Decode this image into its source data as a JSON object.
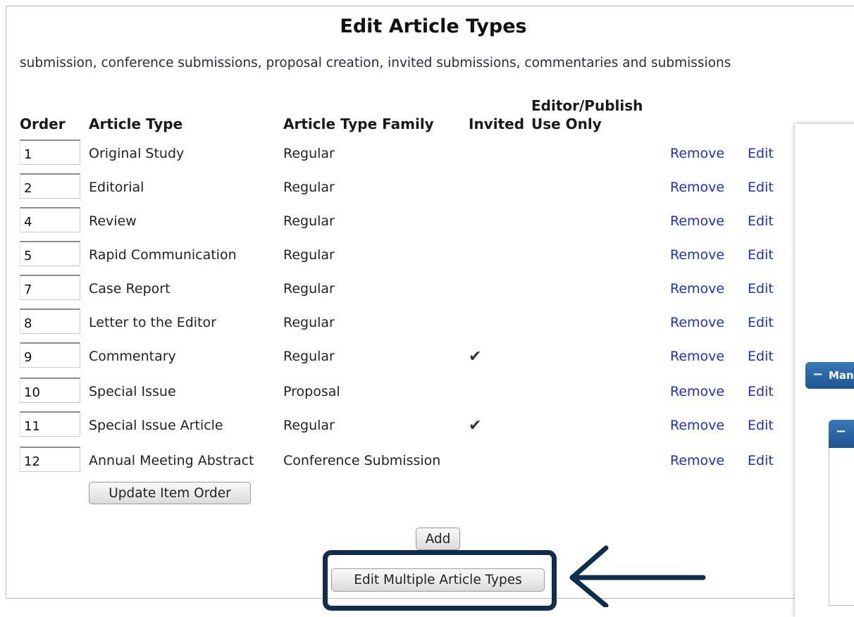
{
  "page": {
    "title": "Edit Article Types",
    "subtitle": "submission, conference submissions, proposal creation, invited submissions, commentaries and submissions"
  },
  "table": {
    "headers": {
      "order": "Order",
      "article_type": "Article Type",
      "family": "Article Type Family",
      "invited": "Invited",
      "editor_line1": "Editor/Publish",
      "editor_line2": "Use Only"
    },
    "rows": [
      {
        "order": "1",
        "type": "Original Study",
        "family": "Regular",
        "invited": false
      },
      {
        "order": "2",
        "type": "Editorial",
        "family": "Regular",
        "invited": false
      },
      {
        "order": "4",
        "type": "Review",
        "family": "Regular",
        "invited": false
      },
      {
        "order": "5",
        "type": "Rapid Communication",
        "family": "Regular",
        "invited": false
      },
      {
        "order": "7",
        "type": "Case Report",
        "family": "Regular",
        "invited": false
      },
      {
        "order": "8",
        "type": "Letter to the Editor",
        "family": "Regular",
        "invited": false
      },
      {
        "order": "9",
        "type": "Commentary",
        "family": "Regular",
        "invited": true
      },
      {
        "order": "10",
        "type": "Special Issue",
        "family": "Proposal",
        "invited": false
      },
      {
        "order": "11",
        "type": "Special Issue Article",
        "family": "Regular",
        "invited": true
      },
      {
        "order": "12",
        "type": "Annual Meeting Abstract",
        "family": "Conference Submission",
        "invited": false
      }
    ],
    "remove_label": "Remove",
    "edit_label": "Edit",
    "check_glyph": "✔"
  },
  "buttons": {
    "update_order": "Update Item Order",
    "add": "Add",
    "edit_multiple": "Edit Multiple Article Types"
  },
  "side_panel": {
    "collapse_glyph": "−",
    "label": "Man"
  },
  "colors": {
    "link": "#1c2fd6",
    "highlight": "#0f2d4d",
    "panel_header": "#2a65a3"
  }
}
